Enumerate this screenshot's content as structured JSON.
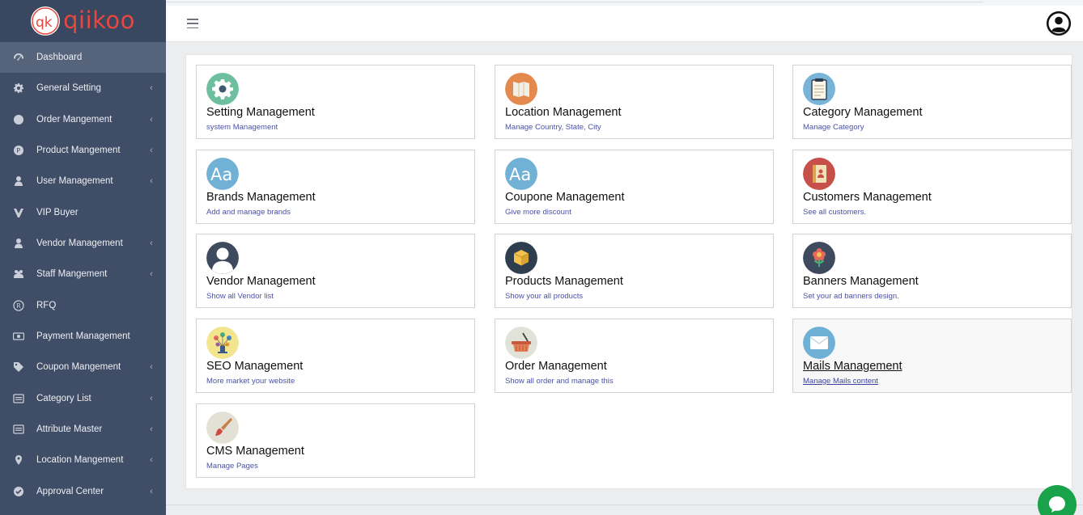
{
  "brand": {
    "name": "qiikoo",
    "mark": "qk"
  },
  "sidebar": {
    "items": [
      {
        "label": "Dashboard",
        "icon": "dashboard-icon",
        "has_submenu": false,
        "active": true
      },
      {
        "label": "General Setting",
        "icon": "gear-icon",
        "has_submenu": true
      },
      {
        "label": "Order Mangement",
        "icon": "circle-icon",
        "has_submenu": true
      },
      {
        "label": "Product Mangement",
        "icon": "product-icon",
        "has_submenu": true
      },
      {
        "label": "User Management",
        "icon": "user-icon",
        "has_submenu": true
      },
      {
        "label": "VIP Buyer",
        "icon": "vip-icon",
        "has_submenu": false
      },
      {
        "label": "Vendor Management",
        "icon": "user-icon",
        "has_submenu": true
      },
      {
        "label": "Staff Mangement",
        "icon": "users-icon",
        "has_submenu": true
      },
      {
        "label": "RFQ",
        "icon": "registered-icon",
        "has_submenu": false
      },
      {
        "label": "Payment Management",
        "icon": "money-icon",
        "has_submenu": false
      },
      {
        "label": "Coupon Mangement",
        "icon": "tags-icon",
        "has_submenu": true
      },
      {
        "label": "Category List",
        "icon": "list-icon",
        "has_submenu": true
      },
      {
        "label": "Attribute Master",
        "icon": "list-icon",
        "has_submenu": true
      },
      {
        "label": "Location Mangement",
        "icon": "map-marker-icon",
        "has_submenu": true
      },
      {
        "label": "Approval Center",
        "icon": "check-circle-icon",
        "has_submenu": true
      }
    ],
    "chevron": "‹"
  },
  "cards": [
    {
      "title": "Setting Management",
      "subtitle": "system Management",
      "icon": "settings-icon",
      "color": "#6dbf9f"
    },
    {
      "title": "Location Management",
      "subtitle": "Manage Country, State, City",
      "icon": "map-icon",
      "color": "#e58a4e"
    },
    {
      "title": "Category Management",
      "subtitle": "Manage Category",
      "icon": "clipboard-icon",
      "color": "#78b4d8"
    },
    {
      "title": "Brands Management",
      "subtitle": "Add and manage brands",
      "icon": "font-icon",
      "color": "#72b1d6"
    },
    {
      "title": "Coupone Management",
      "subtitle": "Give more discount",
      "icon": "font-icon",
      "color": "#72b1d6"
    },
    {
      "title": "Customers Management",
      "subtitle": "See all customers.",
      "icon": "address-book-icon",
      "color": "#c8504a"
    },
    {
      "title": "Vendor Management",
      "subtitle": "Show all Vendor list",
      "icon": "user-silhouette-icon",
      "color": "#3e4a5e"
    },
    {
      "title": "Products Management",
      "subtitle": "Show your all products",
      "icon": "box-icon",
      "color": "#2f3e4e"
    },
    {
      "title": "Banners Management",
      "subtitle": "Set your ad banners design.",
      "icon": "flower-icon",
      "color": "#3e4a5e"
    },
    {
      "title": "SEO Management",
      "subtitle": "More market your website",
      "icon": "seo-icon",
      "color": "#f3e48e"
    },
    {
      "title": "Order Management",
      "subtitle": "Show all order and manage this",
      "icon": "basket-icon",
      "color": "#e1e3d9"
    },
    {
      "title": "Mails Management",
      "subtitle": "Manage Mails content",
      "icon": "mail-icon",
      "color": "#6fb1d6",
      "hovered": true
    },
    {
      "title": "CMS Management",
      "subtitle": "Manage Pages",
      "icon": "brush-icon",
      "color": "#e3e1d5"
    }
  ]
}
